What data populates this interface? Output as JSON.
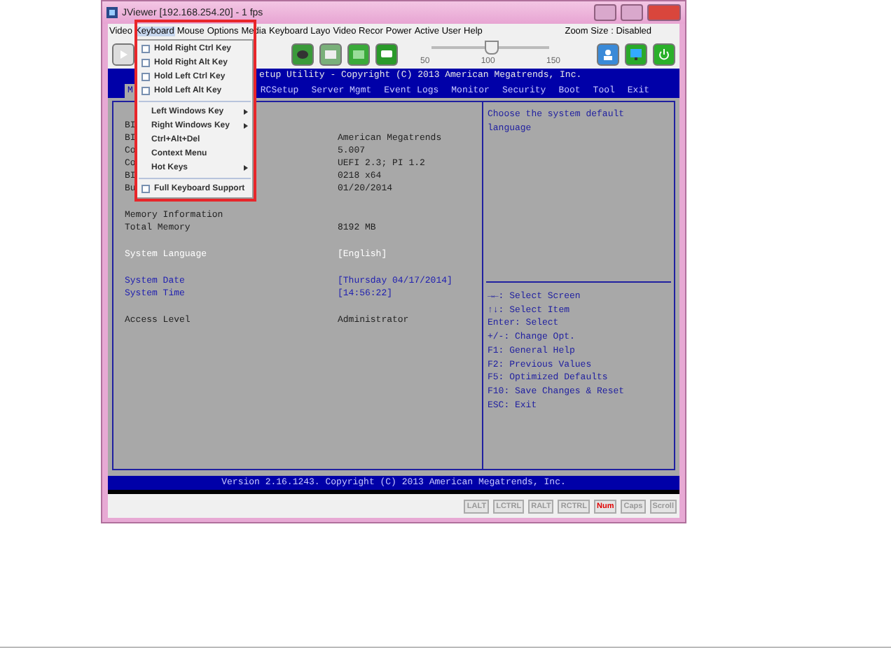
{
  "window": {
    "title": "JViewer [192.168.254.20] - 1 fps"
  },
  "menu_bar": {
    "items": [
      {
        "label": "Video",
        "selected": false
      },
      {
        "label": "Keyboard",
        "selected": true
      },
      {
        "label": "Mouse",
        "selected": false
      },
      {
        "label": "Options",
        "selected": false
      },
      {
        "label": "Media",
        "selected": false
      },
      {
        "label": "Keyboard Layo",
        "selected": false
      },
      {
        "label": "Video Recor",
        "selected": false
      },
      {
        "label": "Power",
        "selected": false
      },
      {
        "label": "Active User",
        "selected": false
      },
      {
        "label": "Help",
        "selected": false
      }
    ],
    "zoom_status": "Zoom Size : Disabled"
  },
  "toolbar": {
    "slider": {
      "level": 0.5,
      "ticks": [
        "50",
        "100",
        "150"
      ]
    }
  },
  "keyboard_menu": {
    "groups": [
      [
        {
          "kind": "check",
          "label": "Hold Right Ctrl Key",
          "checked": false
        },
        {
          "kind": "check",
          "label": "Hold Right Alt Key",
          "checked": false
        },
        {
          "kind": "check",
          "label": "Hold Left Ctrl Key",
          "checked": false
        },
        {
          "kind": "check",
          "label": "Hold Left Alt Key",
          "checked": false
        }
      ],
      [
        {
          "kind": "submenu",
          "label": "Left Windows Key"
        },
        {
          "kind": "submenu",
          "label": "Right Windows Key"
        },
        {
          "kind": "action",
          "label": "Ctrl+Alt+Del"
        },
        {
          "kind": "action",
          "label": "Context Menu"
        },
        {
          "kind": "submenu",
          "label": "Hot Keys"
        }
      ],
      [
        {
          "kind": "check",
          "label": "Full Keyboard Support",
          "checked": false
        }
      ]
    ]
  },
  "bios": {
    "title": "etup Utility - Copyright (C) 2013 American Megatrends, Inc.",
    "tabs": [
      {
        "label": "M",
        "selected": true
      },
      {
        "label": "RCSetup",
        "selected": false
      },
      {
        "label": "Server Mgmt",
        "selected": false
      },
      {
        "label": "Event Logs",
        "selected": false
      },
      {
        "label": "Monitor",
        "selected": false
      },
      {
        "label": "Security",
        "selected": false
      },
      {
        "label": "Boot",
        "selected": false
      },
      {
        "label": "Tool",
        "selected": false
      },
      {
        "label": "Exit",
        "selected": false
      }
    ],
    "sections": [
      [
        {
          "kind": "info",
          "label": "BI"
        },
        {
          "kind": "info",
          "label": "BI",
          "value": "American Megatrends"
        },
        {
          "kind": "info",
          "label": "Co",
          "value": "5.007"
        },
        {
          "kind": "info",
          "label": "Co",
          "value": "UEFI 2.3; PI 1.2"
        },
        {
          "kind": "info",
          "label": "BI",
          "value": "0218 x64"
        },
        {
          "kind": "info",
          "label": "Bu",
          "value": "01/20/2014"
        }
      ],
      [
        {
          "kind": "info",
          "label": "Memory Information"
        },
        {
          "kind": "info",
          "label": "Total Memory",
          "value": "8192 MB"
        }
      ],
      [
        {
          "kind": "editable",
          "label": "System Language",
          "value": "[English]",
          "selected": true
        }
      ],
      [
        {
          "kind": "editable",
          "label": "System Date",
          "value": "[Thursday 04/17/2014]",
          "selected": false
        },
        {
          "kind": "editable",
          "label": "System Time",
          "value": "[14:56:22]",
          "selected": false
        }
      ],
      [
        {
          "kind": "info",
          "label": "Access Level",
          "value": "Administrator"
        }
      ]
    ],
    "help": "Choose the system default language",
    "keys": [
      "→←: Select Screen",
      "↑↓: Select Item",
      "Enter: Select",
      "+/-: Change Opt.",
      "F1: General Help",
      "F2: Previous Values",
      "F5: Optimized Defaults",
      "F10: Save Changes & Reset",
      "ESC: Exit"
    ],
    "footer": "Version 2.16.1243. Copyright (C) 2013 American Megatrends, Inc."
  },
  "status_keys": [
    {
      "label": "LALT",
      "on": false
    },
    {
      "label": "LCTRL",
      "on": false
    },
    {
      "label": "RALT",
      "on": false
    },
    {
      "label": "RCTRL",
      "on": false
    },
    {
      "label": "Num",
      "on": true
    },
    {
      "label": "Caps",
      "on": false
    },
    {
      "label": "Scroll",
      "on": false
    }
  ]
}
